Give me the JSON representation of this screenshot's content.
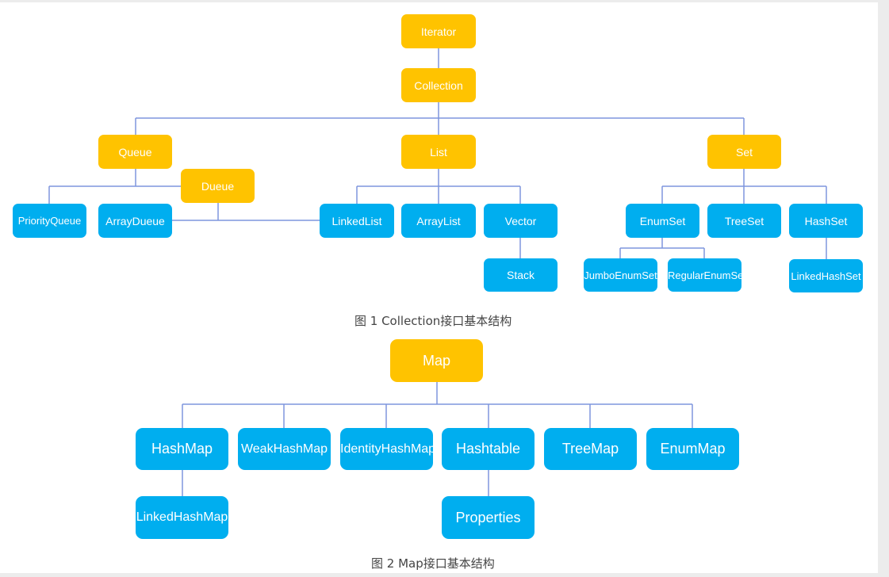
{
  "colors": {
    "interface": "#ffc300",
    "implementation": "#00aeef",
    "connector": "#7f96dd"
  },
  "figure1": {
    "caption": "图 1  Collection接口基本结构",
    "nodes": {
      "iterator": "Iterator",
      "collection": "Collection",
      "queue": "Queue",
      "list": "List",
      "set": "Set",
      "dueue": "Dueue",
      "priority_queue": "PriorityQueue",
      "array_dueue": "ArrayDueue",
      "linked_list": "LinkedList",
      "array_list": "ArrayList",
      "vector": "Vector",
      "stack": "Stack",
      "enum_set": "EnumSet",
      "tree_set": "TreeSet",
      "hash_set": "HashSet",
      "jumbo_enum_set": "JumboEnumSet",
      "regular_enum_set": "RegularEnumSet",
      "linked_hash_set": "LinkedHashSet"
    }
  },
  "figure2": {
    "caption": "图 2  Map接口基本结构",
    "nodes": {
      "map": "Map",
      "hash_map": "HashMap",
      "weak_hash_map": "WeakHashMap",
      "identity_hash_map": "IdentityHashMap",
      "hashtable": "Hashtable",
      "tree_map": "TreeMap",
      "enum_map": "EnumMap",
      "linked_hash_map": "LinkedHashMap",
      "properties": "Properties"
    }
  }
}
